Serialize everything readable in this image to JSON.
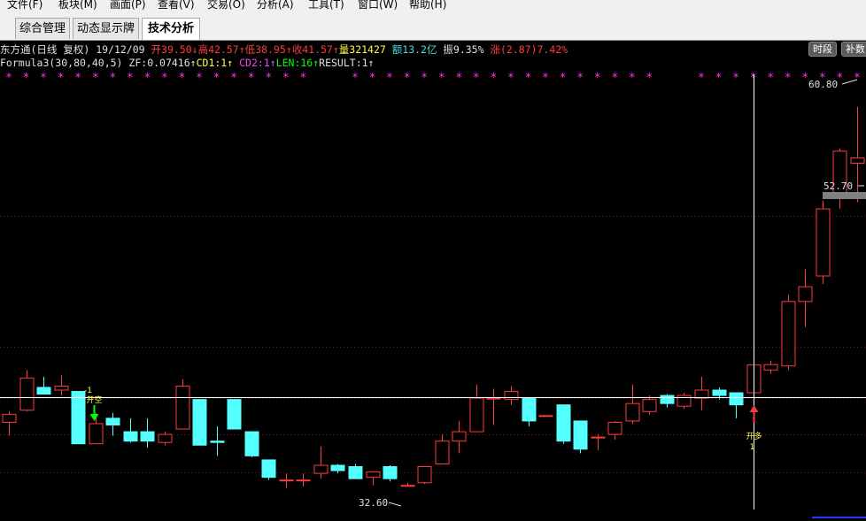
{
  "menu": [
    "文件(F)",
    "板块(M)",
    "画面(P)",
    "查看(V)",
    "交易(O)",
    "分析(A)",
    "工具(T)",
    "窗口(W)",
    "帮助(H)"
  ],
  "tabs": [
    {
      "label": "综合管理",
      "active": false
    },
    {
      "label": "动态显示牌",
      "active": false
    },
    {
      "label": "技术分析",
      "active": true
    }
  ],
  "header": {
    "stock": "东方通(日线 复权) 19/12/09",
    "open": "开39.50",
    "high": "高42.57",
    "low": "低38.95",
    "close": "收41.57",
    "volume": "量321427",
    "amount": "额13.2亿",
    "amplitude": "振9.35%",
    "change": "涨(2.87)7.42%"
  },
  "formula": {
    "name": "Formula3(30,80,40,5)",
    "zf": "ZF:0.07416",
    "cd1": "CD1:1",
    "cd2": "CD2:1",
    "len": "LEN:16",
    "result": "RESULT:1"
  },
  "buttons": {
    "timeshare": "时段",
    "supplement": "补数"
  },
  "chart_data": {
    "type": "candlestick",
    "price_axis_range": [
      31.2,
      62.5
    ],
    "candles": [
      {
        "o": 37.3,
        "h": 38.1,
        "l": 36.3,
        "c": 37.9
      },
      {
        "o": 38.2,
        "h": 41.2,
        "l": 38.1,
        "c": 40.6
      },
      {
        "o": 39.9,
        "h": 40.7,
        "l": 39.5,
        "c": 39.4
      },
      {
        "o": 39.7,
        "h": 40.8,
        "l": 39.3,
        "c": 40.0
      },
      {
        "o": 39.6,
        "h": 39.6,
        "l": 35.7,
        "c": 35.7
      },
      {
        "o": 35.7,
        "h": 38.0,
        "l": 35.7,
        "c": 37.2
      },
      {
        "o": 37.6,
        "h": 38.0,
        "l": 36.3,
        "c": 37.1
      },
      {
        "o": 36.6,
        "h": 37.6,
        "l": 35.8,
        "c": 35.9
      },
      {
        "o": 36.6,
        "h": 37.6,
        "l": 35.4,
        "c": 35.9
      },
      {
        "o": 35.8,
        "h": 36.6,
        "l": 35.6,
        "c": 36.4
      },
      {
        "o": 36.8,
        "h": 40.5,
        "l": 36.8,
        "c": 40.0
      },
      {
        "o": 39.0,
        "h": 39.0,
        "l": 35.6,
        "c": 35.6
      },
      {
        "o": 35.9,
        "h": 37.0,
        "l": 34.8,
        "c": 35.8
      },
      {
        "o": 39.0,
        "h": 39.0,
        "l": 36.8,
        "c": 36.8
      },
      {
        "o": 36.6,
        "h": 36.6,
        "l": 34.7,
        "c": 34.8
      },
      {
        "o": 34.5,
        "h": 34.5,
        "l": 33.0,
        "c": 33.2
      },
      {
        "o": 33.0,
        "h": 33.5,
        "l": 32.4,
        "c": 33.0
      },
      {
        "o": 33.0,
        "h": 33.5,
        "l": 32.5,
        "c": 33.0
      },
      {
        "o": 33.5,
        "h": 35.5,
        "l": 33.1,
        "c": 34.1
      },
      {
        "o": 34.1,
        "h": 34.2,
        "l": 33.5,
        "c": 33.7
      },
      {
        "o": 34.0,
        "h": 34.2,
        "l": 33.1,
        "c": 33.1
      },
      {
        "o": 33.2,
        "h": 33.6,
        "l": 32.6,
        "c": 33.6
      },
      {
        "o": 34.0,
        "h": 34.1,
        "l": 32.9,
        "c": 33.1
      },
      {
        "o": 32.6,
        "h": 32.8,
        "l": 32.6,
        "c": 32.6
      },
      {
        "o": 32.8,
        "h": 34.0,
        "l": 32.7,
        "c": 34.0
      },
      {
        "o": 34.2,
        "h": 36.4,
        "l": 34.2,
        "c": 35.9
      },
      {
        "o": 35.9,
        "h": 37.4,
        "l": 35.0,
        "c": 36.6
      },
      {
        "o": 36.6,
        "h": 40.1,
        "l": 36.6,
        "c": 39.1
      },
      {
        "o": 39.1,
        "h": 39.8,
        "l": 37.1,
        "c": 39.1
      },
      {
        "o": 39.0,
        "h": 40.0,
        "l": 38.6,
        "c": 39.6
      },
      {
        "o": 39.1,
        "h": 39.1,
        "l": 37.0,
        "c": 37.4
      },
      {
        "o": 37.8,
        "h": 37.8,
        "l": 37.8,
        "c": 37.8
      },
      {
        "o": 38.6,
        "h": 38.6,
        "l": 35.7,
        "c": 35.9
      },
      {
        "o": 37.4,
        "h": 37.4,
        "l": 35.0,
        "c": 35.3
      },
      {
        "o": 36.2,
        "h": 36.4,
        "l": 35.2,
        "c": 36.2
      },
      {
        "o": 36.4,
        "h": 37.4,
        "l": 36.0,
        "c": 37.3
      },
      {
        "o": 37.4,
        "h": 40.1,
        "l": 37.2,
        "c": 38.7
      },
      {
        "o": 38.1,
        "h": 39.3,
        "l": 37.9,
        "c": 39.0
      },
      {
        "o": 39.3,
        "h": 39.4,
        "l": 38.4,
        "c": 38.7
      },
      {
        "o": 38.5,
        "h": 39.5,
        "l": 38.3,
        "c": 39.3
      },
      {
        "o": 39.1,
        "h": 40.7,
        "l": 38.2,
        "c": 39.7
      },
      {
        "o": 39.7,
        "h": 39.9,
        "l": 39.0,
        "c": 39.3
      },
      {
        "o": 39.5,
        "h": 39.5,
        "l": 37.6,
        "c": 38.6
      },
      {
        "o": 39.5,
        "h": 42.57,
        "l": 38.95,
        "c": 41.57
      },
      {
        "o": 41.2,
        "h": 41.9,
        "l": 40.9,
        "c": 41.6
      },
      {
        "o": 41.5,
        "h": 46.8,
        "l": 41.2,
        "c": 46.3
      },
      {
        "o": 46.3,
        "h": 48.7,
        "l": 44.4,
        "c": 47.4
      },
      {
        "o": 48.2,
        "h": 53.8,
        "l": 47.6,
        "c": 53.2
      },
      {
        "o": 54.4,
        "h": 57.7,
        "l": 53.2,
        "c": 57.5
      },
      {
        "o": 56.6,
        "h": 60.8,
        "l": 53.7,
        "c": 57.0
      }
    ],
    "reference_levels": [
      42.9,
      39.1,
      36.4,
      33.6,
      52.7
    ],
    "crosshair_price": 39.2,
    "crosshair_candle": 43,
    "labels": {
      "high_label": "60.80",
      "mid_label": "52.70",
      "low_label": "32.60"
    },
    "signals": [
      {
        "candle": 5,
        "type": "sell",
        "text": "开空",
        "value": "-1"
      },
      {
        "candle": 43,
        "type": "buy",
        "text": "开多",
        "value": "1"
      }
    ],
    "top_markers": "*"
  }
}
